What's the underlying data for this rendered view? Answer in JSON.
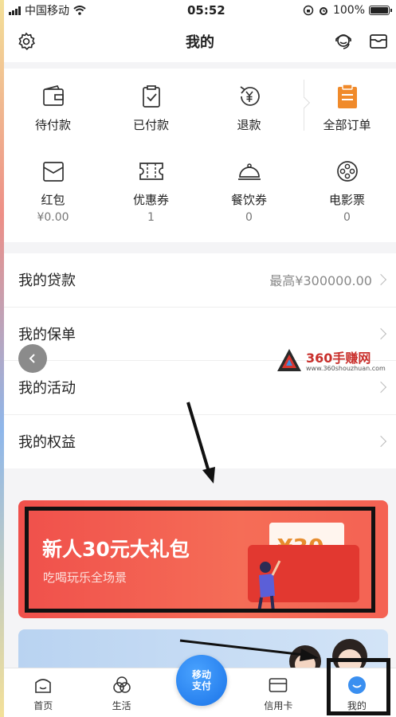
{
  "status_bar": {
    "carrier": "中国移动",
    "time": "05:52",
    "battery": "100%"
  },
  "nav": {
    "title": "我的"
  },
  "orders": [
    {
      "label": "待付款"
    },
    {
      "label": "已付款"
    },
    {
      "label": "退款"
    },
    {
      "label": "全部订单"
    }
  ],
  "assets": [
    {
      "label": "红包",
      "value": "¥0.00"
    },
    {
      "label": "优惠券",
      "value": "1"
    },
    {
      "label": "餐饮券",
      "value": "0"
    },
    {
      "label": "电影票",
      "value": "0"
    }
  ],
  "menu": [
    {
      "label": "我的贷款",
      "extra": "最高¥300000.00"
    },
    {
      "label": "我的保单",
      "extra": ""
    },
    {
      "label": "我的活动",
      "extra": ""
    },
    {
      "label": "我的权益",
      "extra": ""
    }
  ],
  "watermark": {
    "title": "360手赚网",
    "url": "www.360shouzhuan.com"
  },
  "banner": {
    "title": "新人30元大礼包",
    "subtitle": "吃喝玩乐全场景",
    "ticket": "¥30"
  },
  "tabs": [
    {
      "label": "首页"
    },
    {
      "label": "生活"
    },
    {
      "label": "信用卡"
    },
    {
      "label": "我的"
    }
  ],
  "pay": {
    "line1": "移动",
    "line2": "支付"
  },
  "colors": {
    "accent": "#1a73e8",
    "banner": "#f0504b",
    "orders_icon": "#f08a2a"
  }
}
